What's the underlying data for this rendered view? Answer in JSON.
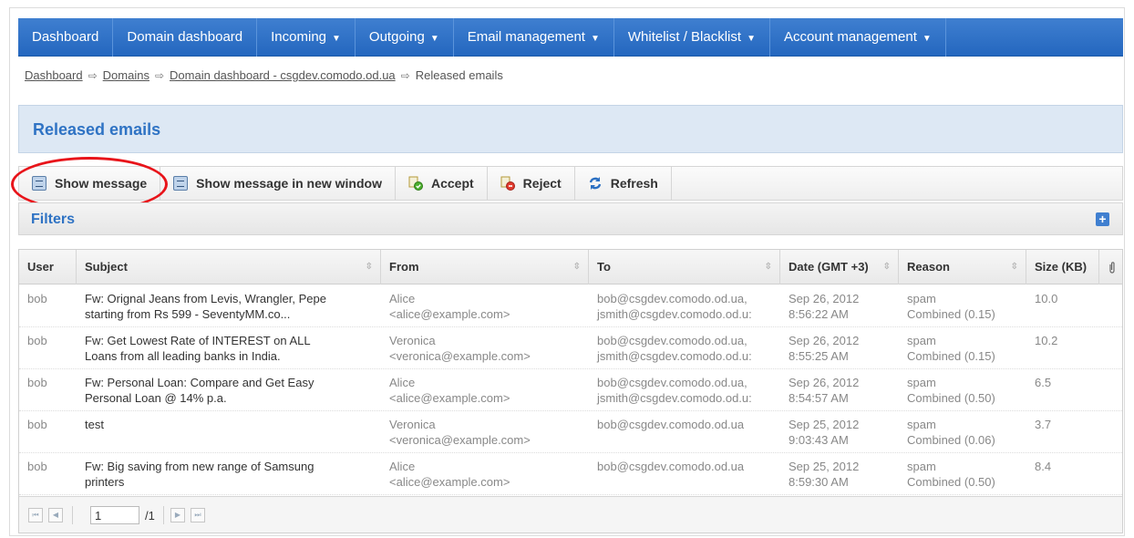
{
  "nav": {
    "items": [
      {
        "label": "Dashboard",
        "caret": ""
      },
      {
        "label": "Domain dashboard",
        "caret": ""
      },
      {
        "label": "Incoming",
        "caret": "▼"
      },
      {
        "label": "Outgoing",
        "caret": "▼"
      },
      {
        "label": "Email management",
        "caret": "▼"
      },
      {
        "label": "Whitelist / Blacklist",
        "caret": "▼"
      },
      {
        "label": "Account management",
        "caret": "▼"
      }
    ]
  },
  "breadcrumb": {
    "items": [
      "Dashboard",
      "Domains",
      "Domain dashboard - csgdev.comodo.od.ua"
    ],
    "current": "Released emails",
    "separator": "⇨"
  },
  "page": {
    "title": "Released emails"
  },
  "toolbar": {
    "show_message": "Show message",
    "show_message_new_window": "Show message in new window",
    "accept": "Accept",
    "reject": "Reject",
    "refresh": "Refresh"
  },
  "filters": {
    "label": "Filters",
    "toggle": "+"
  },
  "grid": {
    "columns": [
      "User",
      "Subject",
      "From",
      "To",
      "Date (GMT +3)",
      "Reason",
      "Size (KB)"
    ],
    "sort_glyph": "⇳",
    "attachment_glyph": "⊘",
    "rows": [
      {
        "user": "bob",
        "subject": [
          "Fw: Orignal Jeans from Levis, Wrangler, Pepe",
          "starting from Rs 599 - SeventyMM.co..."
        ],
        "from": [
          "Alice",
          "<alice@example.com>"
        ],
        "to": [
          "bob@csgdev.comodo.od.ua,",
          "jsmith@csgdev.comodo.od.u:"
        ],
        "date": [
          "Sep 26, 2012",
          "8:56:22 AM"
        ],
        "reason": [
          "spam",
          "Combined (0.15)"
        ],
        "size": "10.0"
      },
      {
        "user": "bob",
        "subject": [
          "Fw: Get Lowest Rate of INTEREST on ALL",
          "Loans from all leading banks in India."
        ],
        "from": [
          "Veronica",
          "<veronica@example.com>"
        ],
        "to": [
          "bob@csgdev.comodo.od.ua,",
          "jsmith@csgdev.comodo.od.u:"
        ],
        "date": [
          "Sep 26, 2012",
          "8:55:25 AM"
        ],
        "reason": [
          "spam",
          "Combined (0.15)"
        ],
        "size": "10.2"
      },
      {
        "user": "bob",
        "subject": [
          "Fw: Personal Loan: Compare and Get Easy",
          "Personal Loan @ 14% p.a."
        ],
        "from": [
          "Alice",
          "<alice@example.com>"
        ],
        "to": [
          "bob@csgdev.comodo.od.ua,",
          "jsmith@csgdev.comodo.od.u:"
        ],
        "date": [
          "Sep 26, 2012",
          "8:54:57 AM"
        ],
        "reason": [
          "spam",
          "Combined (0.50)"
        ],
        "size": "6.5"
      },
      {
        "user": "bob",
        "subject": [
          "test",
          ""
        ],
        "from": [
          "Veronica",
          "<veronica@example.com>"
        ],
        "to": [
          "bob@csgdev.comodo.od.ua",
          ""
        ],
        "date": [
          "Sep 25, 2012",
          "9:03:43 AM"
        ],
        "reason": [
          "spam",
          "Combined (0.06)"
        ],
        "size": "3.7"
      },
      {
        "user": "bob",
        "subject": [
          "Fw: Big saving from new range of Samsung",
          "printers"
        ],
        "from": [
          "Alice",
          "<alice@example.com>"
        ],
        "to": [
          "bob@csgdev.comodo.od.ua",
          ""
        ],
        "date": [
          "Sep 25, 2012",
          "8:59:30 AM"
        ],
        "reason": [
          "spam",
          "Combined (0.50)"
        ],
        "size": "8.4"
      }
    ]
  },
  "pager": {
    "page": "1",
    "total": "/1",
    "first": "⏮",
    "prev": "◀",
    "next": "▶",
    "last": "⏭"
  },
  "colors": {
    "nav": "#2f73c4",
    "title": "#2f73c4",
    "highlight": "#e8141a"
  }
}
